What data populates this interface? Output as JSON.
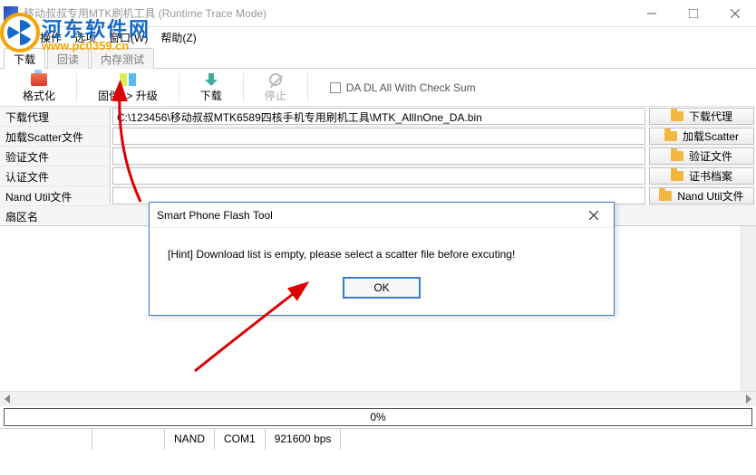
{
  "window": {
    "title": "移动叔叔专用MTK刷机工具 (Runtime Trace Mode)"
  },
  "watermark": {
    "line1": "河东软件网",
    "line2": "www.pc0359.cn"
  },
  "menu": {
    "file": "文件",
    "action": "操作",
    "option": "选项",
    "window": "窗口(W)",
    "help": "帮助(Z)"
  },
  "tabs": {
    "download": "下载",
    "readback": "回读",
    "memtest": "内存测试"
  },
  "toolbar": {
    "format": "格式化",
    "upgrade": "固件 -> 升级",
    "download": "下载",
    "stop": "停止",
    "checksum": "DA DL All With Check Sum"
  },
  "fields": {
    "da_label": "下载代理",
    "da_value": "C:\\123456\\移动叔叔MTK6589四核手机专用刷机工具\\MTK_AllInOne_DA.bin",
    "da_btn": "下载代理",
    "scatter_label": "加载Scatter文件",
    "scatter_value": "",
    "scatter_btn": "加载Scatter",
    "verify_label": "验证文件",
    "verify_value": "",
    "verify_btn": "验证文件",
    "cert_label": "认证文件",
    "cert_value": "",
    "cert_btn": "证书档案",
    "nand_label": "Nand Util文件",
    "nand_value": "",
    "nand_btn": "Nand Util文件"
  },
  "list": {
    "header": "扇区名"
  },
  "progress": {
    "text": "0%"
  },
  "status": {
    "nand": "NAND",
    "com": "COM1",
    "baud": "921600 bps"
  },
  "dialog": {
    "title": "Smart Phone Flash Tool",
    "message": "[Hint] Download list is empty, please select a scatter file before excuting!",
    "ok": "OK"
  }
}
